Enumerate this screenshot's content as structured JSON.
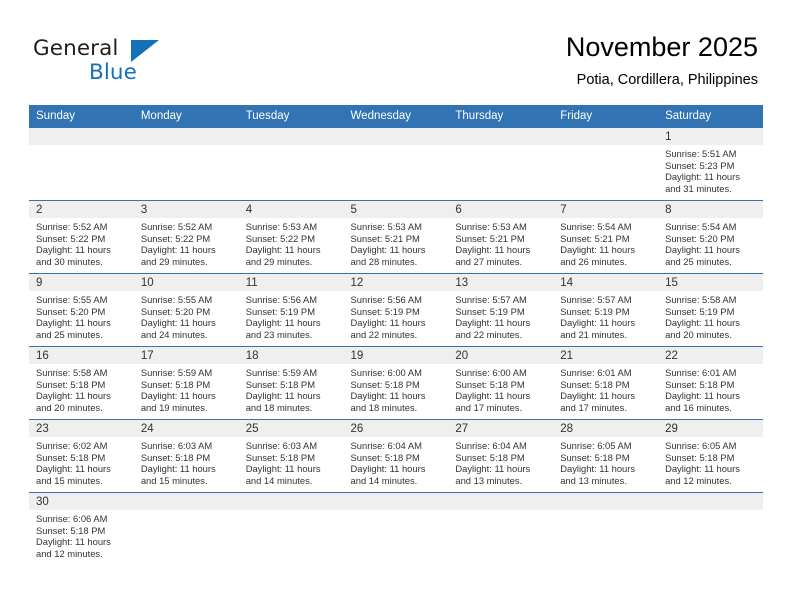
{
  "brand": {
    "name_part1": "General",
    "name_part2": "Blue",
    "triangle_color": "#1470b7",
    "text_color": "#231f20"
  },
  "header": {
    "title": "November 2025",
    "subtitle": "Potia, Cordillera, Philippines"
  },
  "theme": {
    "header_blue": "#3273b3",
    "daynum_band": "#efefef",
    "grid_line": "#3273b3",
    "body_text": "#333333"
  },
  "weekdays": [
    "Sunday",
    "Monday",
    "Tuesday",
    "Wednesday",
    "Thursday",
    "Friday",
    "Saturday"
  ],
  "labels": {
    "sunrise_prefix": "Sunrise:",
    "sunset_prefix": "Sunset:",
    "daylight_prefix": "Daylight:"
  },
  "weeks": [
    [
      {
        "day": "",
        "empty": true
      },
      {
        "day": "",
        "empty": true
      },
      {
        "day": "",
        "empty": true
      },
      {
        "day": "",
        "empty": true
      },
      {
        "day": "",
        "empty": true
      },
      {
        "day": "",
        "empty": true
      },
      {
        "day": "1",
        "sunrise": "Sunrise: 5:51 AM",
        "sunset": "Sunset: 5:23 PM",
        "daylight1": "Daylight: 11 hours",
        "daylight2": "and 31 minutes."
      }
    ],
    [
      {
        "day": "2",
        "sunrise": "Sunrise: 5:52 AM",
        "sunset": "Sunset: 5:22 PM",
        "daylight1": "Daylight: 11 hours",
        "daylight2": "and 30 minutes."
      },
      {
        "day": "3",
        "sunrise": "Sunrise: 5:52 AM",
        "sunset": "Sunset: 5:22 PM",
        "daylight1": "Daylight: 11 hours",
        "daylight2": "and 29 minutes."
      },
      {
        "day": "4",
        "sunrise": "Sunrise: 5:53 AM",
        "sunset": "Sunset: 5:22 PM",
        "daylight1": "Daylight: 11 hours",
        "daylight2": "and 29 minutes."
      },
      {
        "day": "5",
        "sunrise": "Sunrise: 5:53 AM",
        "sunset": "Sunset: 5:21 PM",
        "daylight1": "Daylight: 11 hours",
        "daylight2": "and 28 minutes."
      },
      {
        "day": "6",
        "sunrise": "Sunrise: 5:53 AM",
        "sunset": "Sunset: 5:21 PM",
        "daylight1": "Daylight: 11 hours",
        "daylight2": "and 27 minutes."
      },
      {
        "day": "7",
        "sunrise": "Sunrise: 5:54 AM",
        "sunset": "Sunset: 5:21 PM",
        "daylight1": "Daylight: 11 hours",
        "daylight2": "and 26 minutes."
      },
      {
        "day": "8",
        "sunrise": "Sunrise: 5:54 AM",
        "sunset": "Sunset: 5:20 PM",
        "daylight1": "Daylight: 11 hours",
        "daylight2": "and 25 minutes."
      }
    ],
    [
      {
        "day": "9",
        "sunrise": "Sunrise: 5:55 AM",
        "sunset": "Sunset: 5:20 PM",
        "daylight1": "Daylight: 11 hours",
        "daylight2": "and 25 minutes."
      },
      {
        "day": "10",
        "sunrise": "Sunrise: 5:55 AM",
        "sunset": "Sunset: 5:20 PM",
        "daylight1": "Daylight: 11 hours",
        "daylight2": "and 24 minutes."
      },
      {
        "day": "11",
        "sunrise": "Sunrise: 5:56 AM",
        "sunset": "Sunset: 5:19 PM",
        "daylight1": "Daylight: 11 hours",
        "daylight2": "and 23 minutes."
      },
      {
        "day": "12",
        "sunrise": "Sunrise: 5:56 AM",
        "sunset": "Sunset: 5:19 PM",
        "daylight1": "Daylight: 11 hours",
        "daylight2": "and 22 minutes."
      },
      {
        "day": "13",
        "sunrise": "Sunrise: 5:57 AM",
        "sunset": "Sunset: 5:19 PM",
        "daylight1": "Daylight: 11 hours",
        "daylight2": "and 22 minutes."
      },
      {
        "day": "14",
        "sunrise": "Sunrise: 5:57 AM",
        "sunset": "Sunset: 5:19 PM",
        "daylight1": "Daylight: 11 hours",
        "daylight2": "and 21 minutes."
      },
      {
        "day": "15",
        "sunrise": "Sunrise: 5:58 AM",
        "sunset": "Sunset: 5:19 PM",
        "daylight1": "Daylight: 11 hours",
        "daylight2": "and 20 minutes."
      }
    ],
    [
      {
        "day": "16",
        "sunrise": "Sunrise: 5:58 AM",
        "sunset": "Sunset: 5:18 PM",
        "daylight1": "Daylight: 11 hours",
        "daylight2": "and 20 minutes."
      },
      {
        "day": "17",
        "sunrise": "Sunrise: 5:59 AM",
        "sunset": "Sunset: 5:18 PM",
        "daylight1": "Daylight: 11 hours",
        "daylight2": "and 19 minutes."
      },
      {
        "day": "18",
        "sunrise": "Sunrise: 5:59 AM",
        "sunset": "Sunset: 5:18 PM",
        "daylight1": "Daylight: 11 hours",
        "daylight2": "and 18 minutes."
      },
      {
        "day": "19",
        "sunrise": "Sunrise: 6:00 AM",
        "sunset": "Sunset: 5:18 PM",
        "daylight1": "Daylight: 11 hours",
        "daylight2": "and 18 minutes."
      },
      {
        "day": "20",
        "sunrise": "Sunrise: 6:00 AM",
        "sunset": "Sunset: 5:18 PM",
        "daylight1": "Daylight: 11 hours",
        "daylight2": "and 17 minutes."
      },
      {
        "day": "21",
        "sunrise": "Sunrise: 6:01 AM",
        "sunset": "Sunset: 5:18 PM",
        "daylight1": "Daylight: 11 hours",
        "daylight2": "and 17 minutes."
      },
      {
        "day": "22",
        "sunrise": "Sunrise: 6:01 AM",
        "sunset": "Sunset: 5:18 PM",
        "daylight1": "Daylight: 11 hours",
        "daylight2": "and 16 minutes."
      }
    ],
    [
      {
        "day": "23",
        "sunrise": "Sunrise: 6:02 AM",
        "sunset": "Sunset: 5:18 PM",
        "daylight1": "Daylight: 11 hours",
        "daylight2": "and 15 minutes."
      },
      {
        "day": "24",
        "sunrise": "Sunrise: 6:03 AM",
        "sunset": "Sunset: 5:18 PM",
        "daylight1": "Daylight: 11 hours",
        "daylight2": "and 15 minutes."
      },
      {
        "day": "25",
        "sunrise": "Sunrise: 6:03 AM",
        "sunset": "Sunset: 5:18 PM",
        "daylight1": "Daylight: 11 hours",
        "daylight2": "and 14 minutes."
      },
      {
        "day": "26",
        "sunrise": "Sunrise: 6:04 AM",
        "sunset": "Sunset: 5:18 PM",
        "daylight1": "Daylight: 11 hours",
        "daylight2": "and 14 minutes."
      },
      {
        "day": "27",
        "sunrise": "Sunrise: 6:04 AM",
        "sunset": "Sunset: 5:18 PM",
        "daylight1": "Daylight: 11 hours",
        "daylight2": "and 13 minutes."
      },
      {
        "day": "28",
        "sunrise": "Sunrise: 6:05 AM",
        "sunset": "Sunset: 5:18 PM",
        "daylight1": "Daylight: 11 hours",
        "daylight2": "and 13 minutes."
      },
      {
        "day": "29",
        "sunrise": "Sunrise: 6:05 AM",
        "sunset": "Sunset: 5:18 PM",
        "daylight1": "Daylight: 11 hours",
        "daylight2": "and 12 minutes."
      }
    ],
    [
      {
        "day": "30",
        "sunrise": "Sunrise: 6:06 AM",
        "sunset": "Sunset: 5:18 PM",
        "daylight1": "Daylight: 11 hours",
        "daylight2": "and 12 minutes."
      },
      {
        "day": "",
        "empty": true
      },
      {
        "day": "",
        "empty": true
      },
      {
        "day": "",
        "empty": true
      },
      {
        "day": "",
        "empty": true
      },
      {
        "day": "",
        "empty": true
      },
      {
        "day": "",
        "empty": true
      }
    ]
  ]
}
